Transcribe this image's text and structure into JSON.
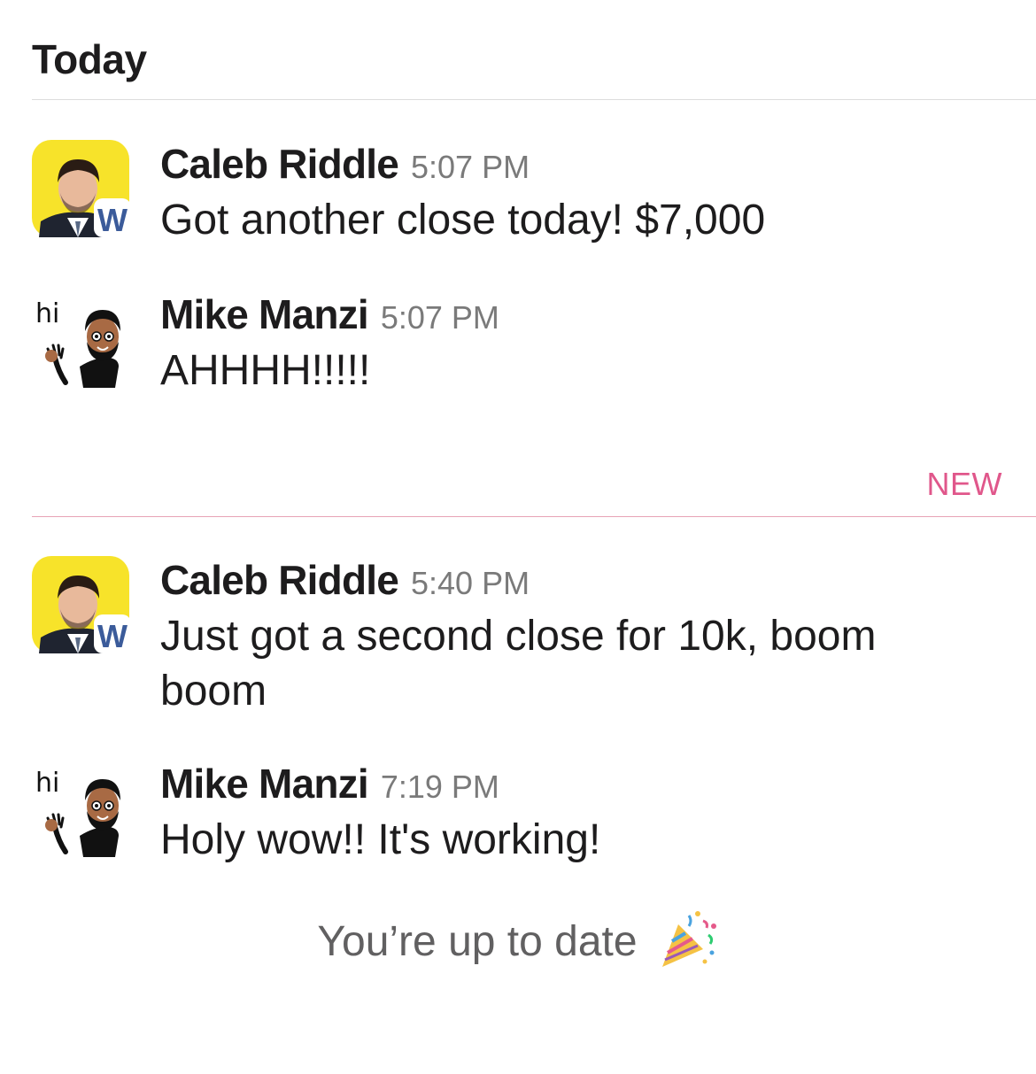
{
  "day_header": "Today",
  "new_label": "NEW",
  "messages": [
    {
      "author": "Caleb Riddle",
      "time": "5:07 PM",
      "text": "Got another close today! $7,000"
    },
    {
      "author": "Mike Manzi",
      "time": "5:07 PM",
      "text": "AHHHH!!!!!"
    },
    {
      "author": "Caleb Riddle",
      "time": "5:40 PM",
      "text": "Just got a second close for 10k, boom boom"
    },
    {
      "author": "Mike Manzi",
      "time": "7:19 PM",
      "text": "Holy wow!! It's working!"
    }
  ],
  "up_to_date": "You’re up to date",
  "avatars": {
    "caleb": {
      "badge": "W",
      "bg_color": "#f7e32a",
      "badge_color": "#3b5b9a"
    },
    "mike": {
      "sticker_text": "hi"
    }
  },
  "colors": {
    "accent_new": "#e0578b",
    "divider_new": "#e8a3b6"
  }
}
